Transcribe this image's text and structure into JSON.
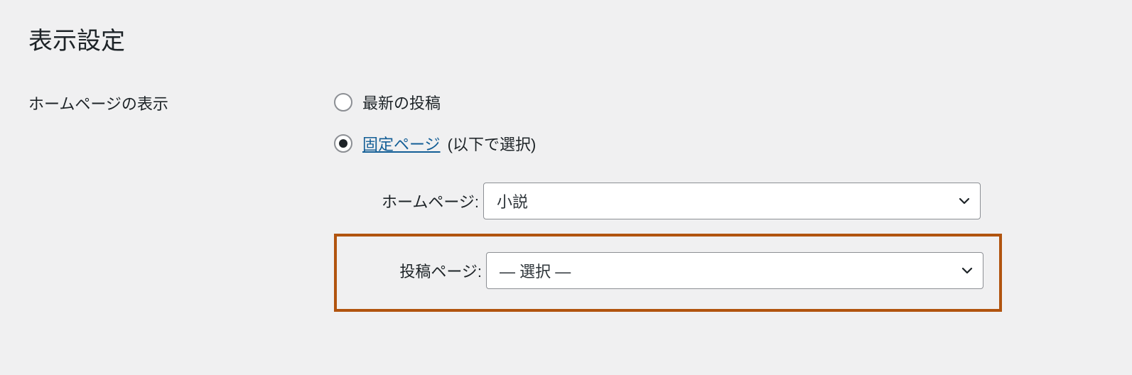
{
  "page": {
    "title": "表示設定"
  },
  "homepage_display": {
    "section_label": "ホームページの表示",
    "options": {
      "latest_posts": {
        "label": "最新の投稿",
        "checked": false
      },
      "static_page": {
        "link_label": "固定ページ",
        "suffix": " (以下で選択)",
        "checked": true
      }
    },
    "homepage_select": {
      "label": "ホームページ:",
      "value": "小説"
    },
    "posts_page_select": {
      "label": "投稿ページ:",
      "value": "— 選択 —"
    }
  }
}
